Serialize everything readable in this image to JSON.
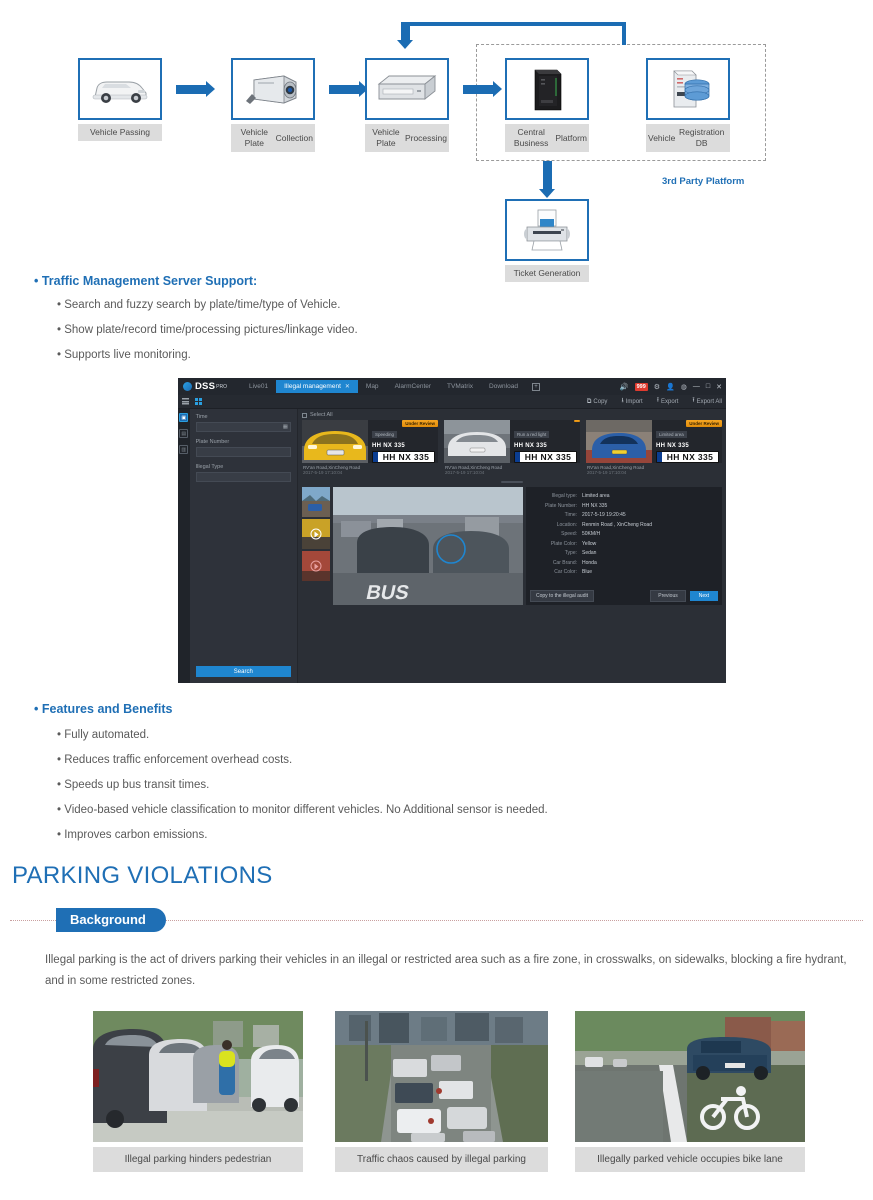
{
  "flow": {
    "nodes": [
      {
        "id": "vehicle-passing",
        "label": "Vehicle Passing",
        "icon": "car-icon"
      },
      {
        "id": "plate-collection",
        "label": "Vehicle Plate\nCollection",
        "label_l1": "Vehicle Plate",
        "label_l2": "Collection",
        "icon": "camera-icon"
      },
      {
        "id": "plate-processing",
        "label": "Vehicle Plate\nProcessing",
        "label_l1": "Vehicle Plate",
        "label_l2": "Processing",
        "icon": "server-box-icon"
      },
      {
        "id": "central-business-platform",
        "label_l1": "Central Business",
        "label_l2": "Platform",
        "icon": "tower-server-icon"
      },
      {
        "id": "vehicle-registration-db",
        "label_l1": "Vehicle",
        "label_l2": "Registration DB",
        "icon": "database-icon"
      },
      {
        "id": "ticket-generation",
        "label": "Ticket Generation",
        "icon": "printer-icon"
      }
    ],
    "group_label": "3rd Party Platform",
    "accent": "#1b6cb3"
  },
  "section_traffic": {
    "heading": "Traffic Management Server Support:",
    "bullets": [
      "Search and fuzzy search by plate/time/type of Vehicle.",
      "Show plate/record time/processing pictures/linkage video.",
      "Supports live monitoring."
    ]
  },
  "dss": {
    "logo": "DSS",
    "logo_sup": "PRO",
    "tabs": [
      {
        "label": "Live01",
        "active": false
      },
      {
        "label": "Illegal management",
        "active": true,
        "closable": true
      },
      {
        "label": "Map",
        "active": false
      },
      {
        "label": "AlarmCenter",
        "active": false
      },
      {
        "label": "TVMatrix",
        "active": false
      },
      {
        "label": "Download",
        "active": false
      }
    ],
    "add_tab": "+",
    "sys": {
      "alarm_badge": "999",
      "settings": "gear-icon",
      "user": "user-icon",
      "help": "help-icon"
    },
    "window": {
      "minimize": "—",
      "maximize": "□",
      "close": "✕"
    },
    "toolbar": [
      {
        "label": "Copy",
        "icon": "copy-icon"
      },
      {
        "label": "Import",
        "icon": "import-icon"
      },
      {
        "label": "Export",
        "icon": "export-icon"
      },
      {
        "label": "Export All",
        "icon": "export-all-icon"
      }
    ],
    "filters": {
      "time_label": "Time",
      "time_value": "",
      "plate_label": "Plate Number",
      "plate_value": "",
      "illegal_label": "Illegal Type",
      "illegal_value": "",
      "search_button": "Search"
    },
    "select_all": "Select All",
    "cards": [
      {
        "violation": "Speeding",
        "plate_text": "HH NX 335",
        "plate_number": "HH  NX 335",
        "badge": "Under Review",
        "road": "RV'an Road,XinCheng Road",
        "time": "2017-5-19 17:10:04",
        "photo": "yellow-car"
      },
      {
        "violation": "Run a red light",
        "plate_text": "HH NX 335",
        "plate_number": "HH  NX 335",
        "badge": "",
        "road": "RV'an Road,XinCheng Road",
        "time": "2017-5-19 17:10:04",
        "photo": "silver-car"
      },
      {
        "violation": "Limited area",
        "plate_text": "HH NX 335",
        "plate_number": "HH  NX 335",
        "badge": "Under Review",
        "road": "RV'an Road,XinCheng Road",
        "time": "2017-5-19 17:10:04",
        "photo": "blue-car"
      }
    ],
    "detail": {
      "rows": [
        {
          "key": "Illegal type:",
          "value": "Limited area"
        },
        {
          "key": "Plate Number:",
          "value": "HH NX 335"
        },
        {
          "key": "Time:",
          "value": "2017-5-19 19:20:45"
        },
        {
          "key": "Location:",
          "value": "Renmin  Road , XinCheng Road"
        },
        {
          "key": "Speed:",
          "value": "50KM/H"
        },
        {
          "key": "Plate Color:",
          "value": "Yellow"
        },
        {
          "key": "Type:",
          "value": "Sedan"
        },
        {
          "key": "Car Brand:",
          "value": "Honda"
        },
        {
          "key": "Car Color:",
          "value": "Blue"
        }
      ],
      "audit_button": "Copy to the illegal audit",
      "previous_button": "Previous",
      "next_button": "Next"
    }
  },
  "section_features": {
    "heading": "Features and Benefits",
    "bullets": [
      "Fully automated.",
      "Reduces traffic enforcement overhead costs.",
      "Speeds up bus transit times.",
      "Video-based vehicle classification to monitor different vehicles. No Additional sensor is needed.",
      "Improves carbon emissions."
    ]
  },
  "parking": {
    "title": "PARKING VIOLATIONS",
    "badge": "Background",
    "paragraph": "Illegal parking is the act of drivers parking their vehicles in an illegal or restricted area such as a fire zone, in crosswalks, on sidewalks, blocking a fire hydrant, and in some restricted zones.",
    "photos": [
      {
        "caption": "Illegal parking hinders pedestrian",
        "scene": "parked-cars-sidewalk"
      },
      {
        "caption": "Traffic chaos caused by illegal parking",
        "scene": "congested-street"
      },
      {
        "caption": "Illegally parked vehicle occupies bike lane",
        "scene": "truck-on-bike-lane"
      }
    ]
  },
  "colors": {
    "brand_blue": "#1f6fb5",
    "arrow_blue": "#1b6cb3",
    "label_grey": "#dcdcdc",
    "text_grey": "#5a5a5a",
    "accent_orange": "#f5a623",
    "dss_blue": "#1f86d0"
  }
}
